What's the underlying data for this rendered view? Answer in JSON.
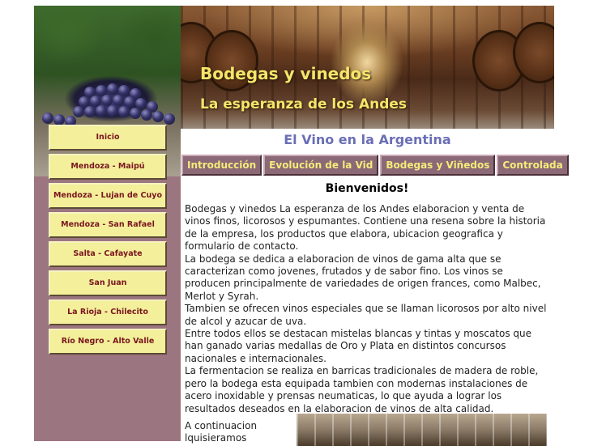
{
  "header": {
    "title": "Bodegas y vinedos",
    "subtitle": "La esperanza de los Andes"
  },
  "sidebar": {
    "items": [
      {
        "label": "Inicio"
      },
      {
        "label": "Mendoza - Maipú"
      },
      {
        "label": "Mendoza - Lujan de Cuyo"
      },
      {
        "label": "Mendoza - San Rafael"
      },
      {
        "label": "Salta - Cafayate"
      },
      {
        "label": "San Juan"
      },
      {
        "label": "La Rioja - Chilecito"
      },
      {
        "label": "Río Negro - Alto Valle"
      }
    ]
  },
  "main": {
    "section_title": "El Vino en la Argentina",
    "tabs": [
      {
        "label": "Introducción"
      },
      {
        "label": "Evolución de la Vid"
      },
      {
        "label": "Bodegas y Viñedos"
      },
      {
        "label": "Controlada"
      }
    ],
    "welcome": "Bienvenidos!",
    "paragraphs": [
      "Bodegas y vinedos La esperanza de los Andes elaboracion y venta de vinos finos, licorosos y espumantes. Contiene una resena sobre la historia de la empresa, los productos que elabora, ubicacion geografica y formulario de contacto.",
      "La bodega se dedica a elaboracion de vinos de gama alta que se caracterizan como jovenes, frutados y de sabor fino. Los vinos se producen principalmente de variedades de origen frances, como Malbec, Merlot y Syrah.",
      "Tambien se ofrecen vinos especiales que se llaman licorosos por alto nivel de alcol y azucar de uva.",
      "Entre todos ellos se destacan mistelas blancas y tintas y moscatos que han ganado varias medallas de Oro y Plata en distintos concursos nacionales e internacionales.",
      "La fermentacion se realiza en barricas tradicionales de madera de roble, pero la bodega esta equipada tambien con modernas instalaciones de acero inoxidable y prensas neumaticas, lo que ayuda a lograr los resultados deseados en la elaboracion de vinos de alta calidad."
    ],
    "continuation_1": "A continuacion",
    "continuation_2": "lquisieramos"
  }
}
